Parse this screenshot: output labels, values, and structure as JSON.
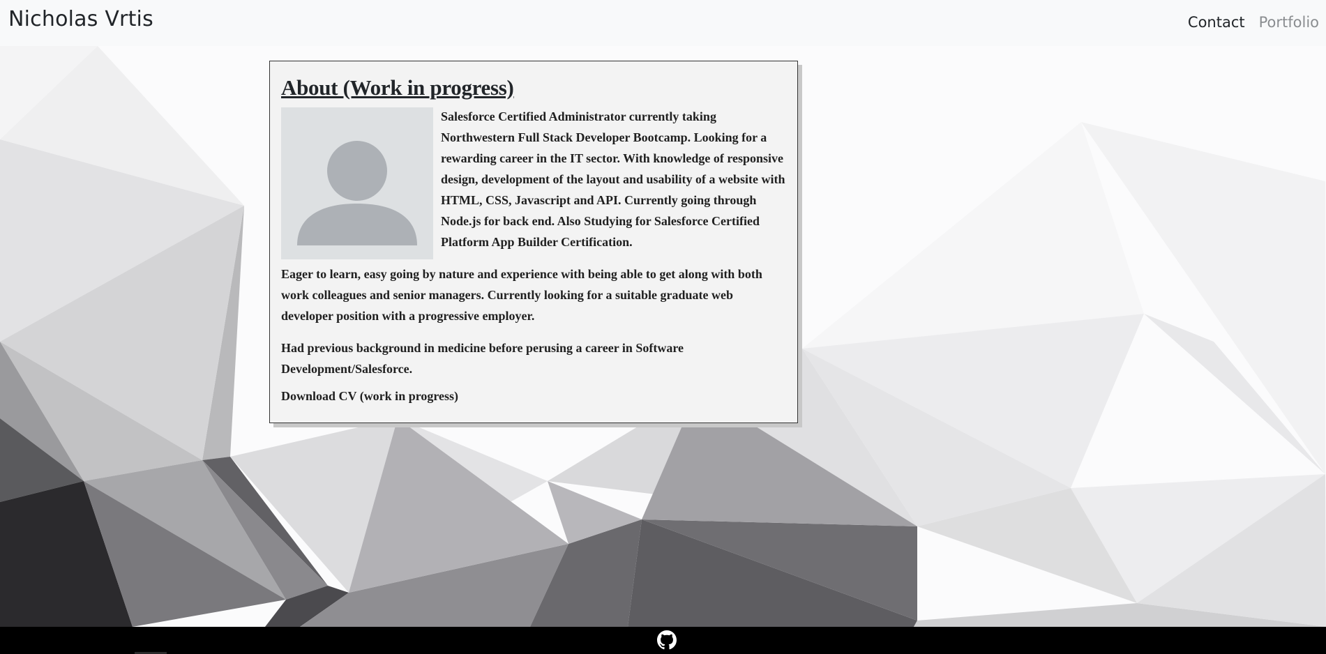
{
  "header": {
    "brand": "Nicholas Vrtis",
    "nav": [
      {
        "label": "Contact"
      },
      {
        "label": "Portfolio"
      }
    ]
  },
  "about": {
    "title": "About (Work in progress)",
    "avatar_icon": "user-placeholder-icon",
    "paragraphs": [
      "Salesforce Certified Administrator currently taking Northwestern Full Stack Developer Bootcamp. Looking for a rewarding career in the IT sector. With knowledge of responsive design, development of the layout and usability of a website with HTML, CSS, Javascript and API. Currently going through Node.js for back end. Also Studying for Salesforce Certified Platform App Builder Certification.",
      "Eager to learn, easy going by nature and experience with being able to get along with both work colleagues and senior managers. Currently looking for a suitable graduate web developer position with a progressive employer.",
      "Had previous background in medicine before perusing a career in Software Development/Salesforce."
    ],
    "cv_link": "Download CV (work in progress)"
  },
  "footer": {
    "icon": "github-icon"
  },
  "colors": {
    "navbar_bg": "#f8f9fa",
    "card_bg": "#f3f3f3",
    "footer_bg": "#000000",
    "avatar_bg": "#dde0e2",
    "avatar_fg": "#adb1b6"
  }
}
